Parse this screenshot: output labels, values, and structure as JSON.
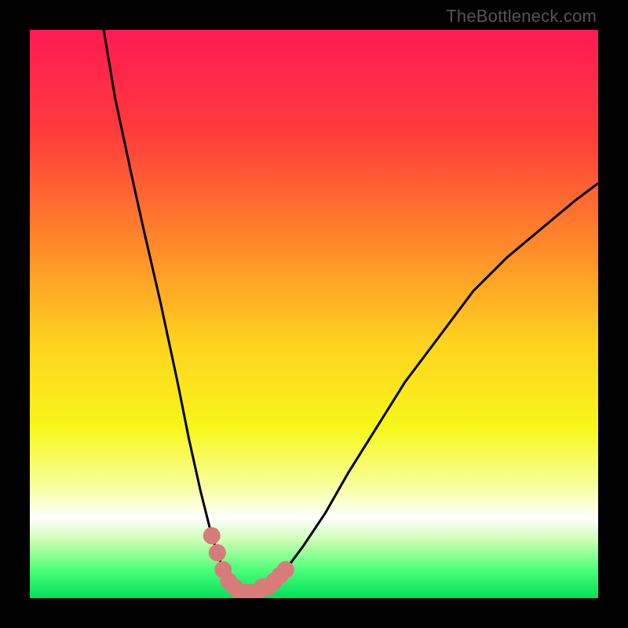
{
  "watermark": "TheBottleneck.com",
  "chart_data": {
    "type": "line",
    "title": "",
    "xlabel": "",
    "ylabel": "",
    "xlim": [
      0,
      100
    ],
    "ylim": [
      0,
      100
    ],
    "grid": false,
    "legend": false,
    "series": [
      {
        "name": "curve",
        "x": [
          13,
          15,
          18,
          20,
          23,
          26,
          28,
          30,
          32,
          34,
          36,
          38,
          40,
          42,
          45,
          48,
          52,
          56,
          61,
          66,
          72,
          78,
          84,
          90,
          96,
          100
        ],
        "y": [
          100,
          88,
          74,
          65,
          52,
          38,
          28,
          19,
          11,
          5,
          2,
          1,
          1,
          2,
          5,
          9,
          15,
          22,
          30,
          38,
          46,
          54,
          60,
          65,
          70,
          73
        ]
      }
    ],
    "markers": {
      "name": "highlight-points",
      "x": [
        32,
        33,
        34,
        35,
        36,
        37,
        38,
        39,
        40,
        41,
        42,
        43,
        44,
        45
      ],
      "y": [
        11,
        8,
        5,
        3,
        2,
        1,
        1,
        1,
        1,
        2,
        2,
        3,
        4,
        5
      ]
    },
    "background_gradient": {
      "stops": [
        {
          "offset": 0.0,
          "color": "#ff1a55"
        },
        {
          "offset": 0.18,
          "color": "#ff3b3b"
        },
        {
          "offset": 0.38,
          "color": "#ff8a2a"
        },
        {
          "offset": 0.55,
          "color": "#ffd21f"
        },
        {
          "offset": 0.7,
          "color": "#f7f71a"
        },
        {
          "offset": 0.8,
          "color": "#f8ff9a"
        },
        {
          "offset": 0.86,
          "color": "#ffffff"
        },
        {
          "offset": 0.9,
          "color": "#c8ffb0"
        },
        {
          "offset": 0.95,
          "color": "#4dff7a"
        },
        {
          "offset": 1.0,
          "color": "#00e05a"
        }
      ]
    },
    "marker_color": "#d97b7b",
    "curve_color": "#000000"
  }
}
